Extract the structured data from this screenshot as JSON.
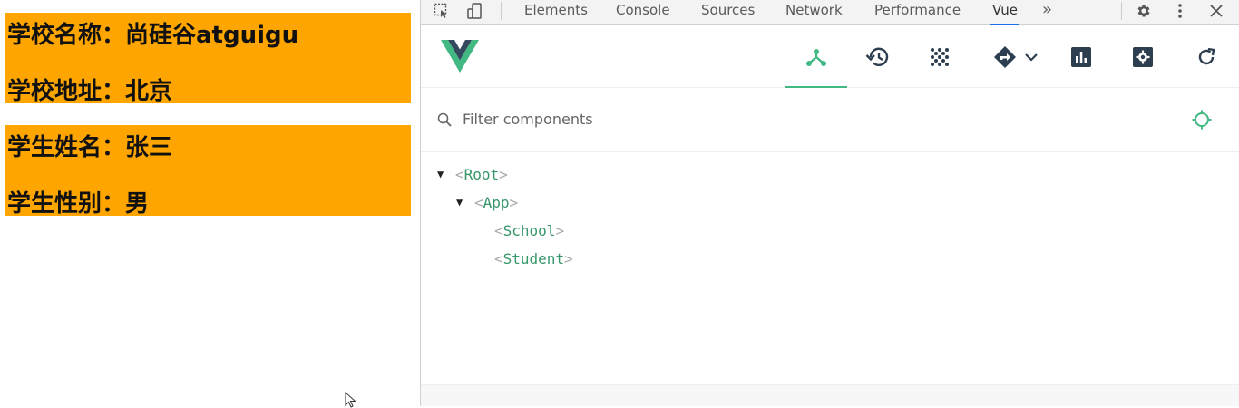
{
  "school": {
    "name_label": "学校名称：",
    "name_value": "尚硅谷atguigu",
    "address_label": "学校地址：",
    "address_value": "北京"
  },
  "student": {
    "name_label": "学生姓名：",
    "name_value": "张三",
    "gender_label": "学生性别：",
    "gender_value": "男"
  },
  "devtools": {
    "tabs": [
      "Elements",
      "Console",
      "Sources",
      "Network",
      "Performance",
      "Vue"
    ],
    "active_tab": "Vue",
    "more_tabs_glyph": "»"
  },
  "vue_panel": {
    "filter_placeholder": "Filter components",
    "tree": [
      {
        "name": "Root",
        "expanded": true
      },
      {
        "name": "App",
        "expanded": true
      },
      {
        "name": "School"
      },
      {
        "name": "Student"
      }
    ]
  },
  "colors": {
    "card_bg": "#ffa500",
    "vue_green": "#42b883",
    "vue_dark": "#35495e",
    "active_tab_underline": "#1a73e8"
  }
}
